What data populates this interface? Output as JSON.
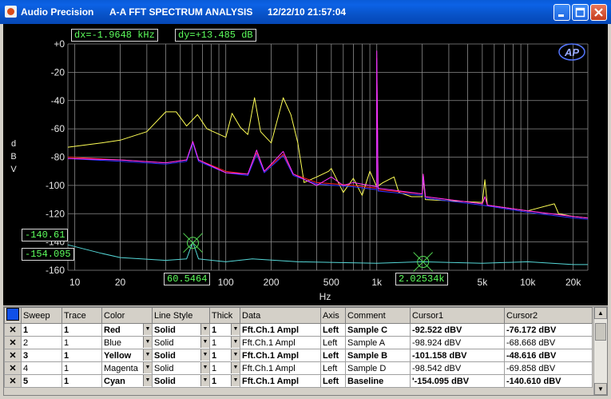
{
  "window": {
    "app_name": "Audio Precision",
    "title": "A-A FFT SPECTRUM ANALYSIS",
    "datetime": "12/22/10 21:57:04"
  },
  "cursor_readouts": {
    "dx": "dx=-1.9648 kHz",
    "dy": "dy=+13.485  dB",
    "y_cursor1": "-140.61",
    "y_cursor2": "-154.095",
    "x_cursor1": "60.5464",
    "x_cursor2": "2.02534k"
  },
  "logo": "AP",
  "colors": {
    "background": "#000000",
    "grid": "#8c8c8c",
    "red": "#ff2020",
    "blue": "#3030ff",
    "yellow": "#ffff55",
    "magenta": "#ff33ff",
    "cyan": "#55d8d8",
    "cursor": "#55dd55"
  },
  "chart_data": {
    "type": "line",
    "title": "",
    "xlabel": "Hz",
    "ylabel": "dBV",
    "xscale": "log",
    "xlim": [
      9,
      25000
    ],
    "ylim": [
      -160,
      0
    ],
    "grid": true,
    "x_tick_labels": [
      "10",
      "20",
      "50",
      "100",
      "200",
      "500",
      "1k",
      "2k",
      "5k",
      "10k",
      "20k"
    ],
    "y_tick_labels": [
      "+0",
      "-20",
      "-40",
      "-60",
      "-80",
      "-100",
      "-120",
      "-140",
      "-160"
    ],
    "y_ticks": [
      0,
      -20,
      -40,
      -60,
      -80,
      -100,
      -120,
      -140,
      -160
    ],
    "cursors": [
      {
        "x": 60.5464,
        "y": -140.61
      },
      {
        "x": 2025.34,
        "y": -154.095
      }
    ],
    "series": [
      {
        "name": "Red",
        "color": "#ff2020",
        "points": [
          [
            9,
            -80
          ],
          [
            20,
            -82
          ],
          [
            40,
            -84
          ],
          [
            55,
            -82
          ],
          [
            60.5,
            -69
          ],
          [
            66,
            -82
          ],
          [
            100,
            -90
          ],
          [
            140,
            -92
          ],
          [
            160,
            -77
          ],
          [
            180,
            -90
          ],
          [
            240,
            -78
          ],
          [
            280,
            -92
          ],
          [
            400,
            -98
          ],
          [
            700,
            -100
          ],
          [
            1000,
            -102
          ],
          [
            1000,
            -10
          ],
          [
            1020,
            -103
          ],
          [
            2000,
            -106
          ],
          [
            2030,
            -92
          ],
          [
            2100,
            -108
          ],
          [
            5000,
            -113
          ],
          [
            5200,
            -108
          ],
          [
            5400,
            -114
          ],
          [
            10000,
            -118
          ],
          [
            20000,
            -122
          ],
          [
            25000,
            -123
          ]
        ]
      },
      {
        "name": "Blue",
        "color": "#3030ff",
        "points": [
          [
            9,
            -81
          ],
          [
            20,
            -83
          ],
          [
            40,
            -85
          ],
          [
            55,
            -83
          ],
          [
            60.5,
            -70
          ],
          [
            66,
            -83
          ],
          [
            100,
            -91
          ],
          [
            140,
            -93
          ],
          [
            160,
            -78
          ],
          [
            180,
            -91
          ],
          [
            240,
            -79
          ],
          [
            280,
            -93
          ],
          [
            400,
            -99
          ],
          [
            700,
            -101
          ],
          [
            1000,
            -103
          ],
          [
            1000,
            -11
          ],
          [
            1020,
            -104
          ],
          [
            2000,
            -107
          ],
          [
            2030,
            -93
          ],
          [
            2100,
            -109
          ],
          [
            5000,
            -114
          ],
          [
            10000,
            -119
          ],
          [
            20000,
            -123
          ],
          [
            25000,
            -124
          ]
        ]
      },
      {
        "name": "Yellow",
        "color": "#ffff55",
        "points": [
          [
            9,
            -73
          ],
          [
            15,
            -70
          ],
          [
            20,
            -68
          ],
          [
            30,
            -62
          ],
          [
            40,
            -48
          ],
          [
            47,
            -48
          ],
          [
            55,
            -58
          ],
          [
            65,
            -50
          ],
          [
            75,
            -60
          ],
          [
            100,
            -66
          ],
          [
            110,
            -49
          ],
          [
            125,
            -59
          ],
          [
            140,
            -64
          ],
          [
            155,
            -38
          ],
          [
            170,
            -62
          ],
          [
            200,
            -70
          ],
          [
            240,
            -38
          ],
          [
            270,
            -50
          ],
          [
            300,
            -70
          ],
          [
            330,
            -98
          ],
          [
            400,
            -94
          ],
          [
            480,
            -90
          ],
          [
            500,
            -88
          ],
          [
            600,
            -105
          ],
          [
            700,
            -95
          ],
          [
            800,
            -107
          ],
          [
            900,
            -90
          ],
          [
            1000,
            -101
          ],
          [
            1100,
            -98
          ],
          [
            1300,
            -94
          ],
          [
            1400,
            -105
          ],
          [
            1700,
            -108
          ],
          [
            2000,
            -108
          ],
          [
            2030,
            -96
          ],
          [
            2100,
            -110
          ],
          [
            5000,
            -112
          ],
          [
            5200,
            -96
          ],
          [
            5400,
            -114
          ],
          [
            10000,
            -118
          ],
          [
            15000,
            -113
          ],
          [
            16000,
            -120
          ],
          [
            20000,
            -122
          ],
          [
            25000,
            -123
          ]
        ]
      },
      {
        "name": "Magenta",
        "color": "#ff33ff",
        "points": [
          [
            9,
            -81
          ],
          [
            20,
            -82
          ],
          [
            40,
            -84
          ],
          [
            55,
            -82
          ],
          [
            60.5,
            -69
          ],
          [
            66,
            -82
          ],
          [
            100,
            -91
          ],
          [
            140,
            -92
          ],
          [
            160,
            -75
          ],
          [
            180,
            -90
          ],
          [
            240,
            -76
          ],
          [
            280,
            -92
          ],
          [
            400,
            -100
          ],
          [
            500,
            -94
          ],
          [
            600,
            -100
          ],
          [
            700,
            -98
          ],
          [
            1000,
            -101
          ],
          [
            1000,
            -5
          ],
          [
            1020,
            -102
          ],
          [
            2000,
            -106
          ],
          [
            2030,
            -92
          ],
          [
            2100,
            -108
          ],
          [
            5000,
            -113
          ],
          [
            5200,
            -108
          ],
          [
            5400,
            -114
          ],
          [
            10000,
            -118
          ],
          [
            20000,
            -122
          ],
          [
            25000,
            -123
          ]
        ]
      },
      {
        "name": "Cyan",
        "color": "#55d8d8",
        "points": [
          [
            9,
            -142
          ],
          [
            15,
            -148
          ],
          [
            20,
            -151
          ],
          [
            40,
            -153
          ],
          [
            55,
            -152
          ],
          [
            60.5,
            -140
          ],
          [
            66,
            -152
          ],
          [
            100,
            -154
          ],
          [
            150,
            -152
          ],
          [
            300,
            -154
          ],
          [
            1000,
            -155
          ],
          [
            2000,
            -154
          ],
          [
            5000,
            -155
          ],
          [
            10000,
            -154
          ],
          [
            20000,
            -156
          ],
          [
            25000,
            -156
          ]
        ]
      }
    ]
  },
  "table": {
    "headers": [
      "Sweep",
      "Trace",
      "Color",
      "Line Style",
      "Thick",
      "Data",
      "Axis",
      "Comment",
      "Cursor1",
      "Cursor2"
    ],
    "rows": [
      {
        "sweep": "1",
        "trace": "1",
        "color": "Red",
        "line_style": "Solid",
        "thick": "1",
        "data": "Fft.Ch.1 Ampl",
        "axis": "Left",
        "comment": "Sample C",
        "cursor1": "-92.522  dBV",
        "cursor2": "-76.172  dBV",
        "bold": true
      },
      {
        "sweep": "2",
        "trace": "1",
        "color": "Blue",
        "line_style": "Solid",
        "thick": "1",
        "data": "Fft.Ch.1 Ampl",
        "axis": "Left",
        "comment": "Sample A",
        "cursor1": "-98.924  dBV",
        "cursor2": "-68.668  dBV",
        "bold": false
      },
      {
        "sweep": "3",
        "trace": "1",
        "color": "Yellow",
        "line_style": "Solid",
        "thick": "1",
        "data": "Fft.Ch.1 Ampl",
        "axis": "Left",
        "comment": "Sample B",
        "cursor1": "-101.158  dBV",
        "cursor2": "-48.616  dBV",
        "bold": true
      },
      {
        "sweep": "4",
        "trace": "1",
        "color": "Magenta",
        "line_style": "Solid",
        "thick": "1",
        "data": "Fft.Ch.1 Ampl",
        "axis": "Left",
        "comment": "Sample D",
        "cursor1": "-98.542  dBV",
        "cursor2": "-69.858  dBV",
        "bold": false
      },
      {
        "sweep": "5",
        "trace": "1",
        "color": "Cyan",
        "line_style": "Solid",
        "thick": "1",
        "data": "Fft.Ch.1 Ampl",
        "axis": "Left",
        "comment": "Baseline",
        "cursor1": "'-154.095  dBV",
        "cursor2": "-140.610  dBV",
        "bold": true
      }
    ]
  }
}
